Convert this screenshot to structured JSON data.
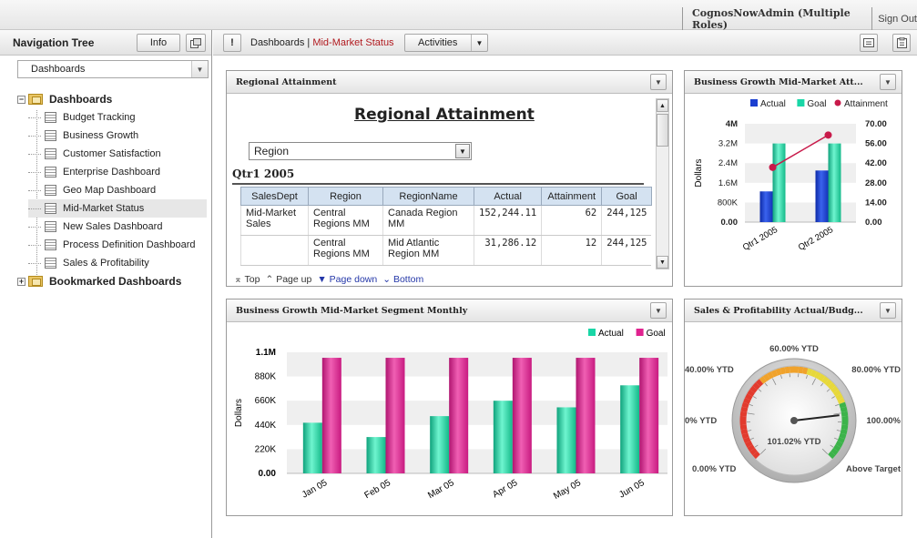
{
  "topbar": {
    "user": "CognosNowAdmin (Multiple Roles)",
    "signout": "Sign Out"
  },
  "nav": {
    "title": "Navigation Tree",
    "info_label": "Info",
    "select_value": "Dashboards",
    "tree": {
      "root_label": "Dashboards",
      "items": [
        "Budget Tracking",
        "Business Growth",
        "Customer Satisfaction",
        "Enterprise Dashboard",
        "Geo Map Dashboard",
        "Mid-Market Status",
        "New Sales Dashboard",
        "Process Definition Dashboard",
        "Sales & Profitability"
      ],
      "selected_index": 5,
      "bookmarked_label": "Bookmarked Dashboards"
    }
  },
  "dashbar": {
    "alert": "!",
    "crumb_parent": "Dashboards",
    "crumb_sep": " | ",
    "crumb_current": "Mid-Market Status",
    "activities_label": "Activities"
  },
  "portlets": {
    "regional": {
      "title": "Regional Attainment",
      "report_title": "Regional Attainment",
      "select_value": "Region",
      "period": "Qtr1 2005",
      "columns": [
        "SalesDept",
        "Region",
        "RegionName",
        "Actual",
        "Attainment",
        "Goal"
      ],
      "rows": [
        [
          "Mid-Market Sales",
          "Central Regions MM",
          "Canada Region MM",
          "152,244.11",
          "62",
          "244,125"
        ],
        [
          "",
          "Central Regions MM",
          "Mid Atlantic Region MM",
          "31,286.12",
          "12",
          "244,125"
        ]
      ],
      "paging": {
        "top": "Top",
        "page_up": "Page up",
        "page_down": "Page down",
        "bottom": "Bottom"
      }
    },
    "growth_qtr": {
      "title": "Business Growth Mid-Market Att..."
    },
    "growth_monthly": {
      "title": "Business Growth Mid-Market Segment Monthly"
    },
    "sales_profit": {
      "title": "Sales & Profitability Actual/Budg..."
    }
  },
  "chart_data": [
    {
      "type": "bar",
      "ylabel": "Dollars",
      "categories": [
        "Qtr1 2005",
        "Qtr2 2005"
      ],
      "series": [
        {
          "name": "Actual",
          "values": [
            1250000,
            2100000
          ],
          "color": "#1b3fd0"
        },
        {
          "name": "Goal",
          "values": [
            3200000,
            3200000
          ],
          "color": "#19d6a6"
        }
      ],
      "line_series": {
        "name": "Attainment",
        "values": [
          39,
          62
        ],
        "color": "#c81a4a"
      },
      "y_ticks": [
        "0.00",
        "800K",
        "1.6M",
        "2.4M",
        "3.2M",
        "4M"
      ],
      "y2_ticks": [
        "0.00",
        "14.00",
        "28.00",
        "42.00",
        "56.00",
        "70.00"
      ],
      "ylim": [
        0,
        4000000
      ],
      "y2lim": [
        0,
        70
      ],
      "legend": "top-right"
    },
    {
      "type": "bar",
      "ylabel": "Dollars",
      "categories": [
        "Jan 05",
        "Feb 05",
        "Mar 05",
        "Apr 05",
        "May 05",
        "Jun 05"
      ],
      "series": [
        {
          "name": "Actual",
          "values": [
            460000,
            330000,
            520000,
            660000,
            600000,
            800000
          ],
          "color": "#19d6a6"
        },
        {
          "name": "Goal",
          "values": [
            1050000,
            1050000,
            1050000,
            1050000,
            1050000,
            1050000
          ],
          "color": "#e0228f"
        }
      ],
      "y_ticks": [
        "0.00",
        "220K",
        "440K",
        "660K",
        "880K",
        "1.1M"
      ],
      "ylim": [
        0,
        1100000
      ],
      "legend": "top-right"
    },
    {
      "type": "gauge",
      "value": 101.02,
      "value_label": "101.02% YTD",
      "scale_labels": [
        "0.00% YTD",
        "0% YTD",
        "40.00% YTD",
        "60.00% YTD",
        "80.00% YTD",
        "100.00%",
        "Above Target"
      ]
    }
  ]
}
